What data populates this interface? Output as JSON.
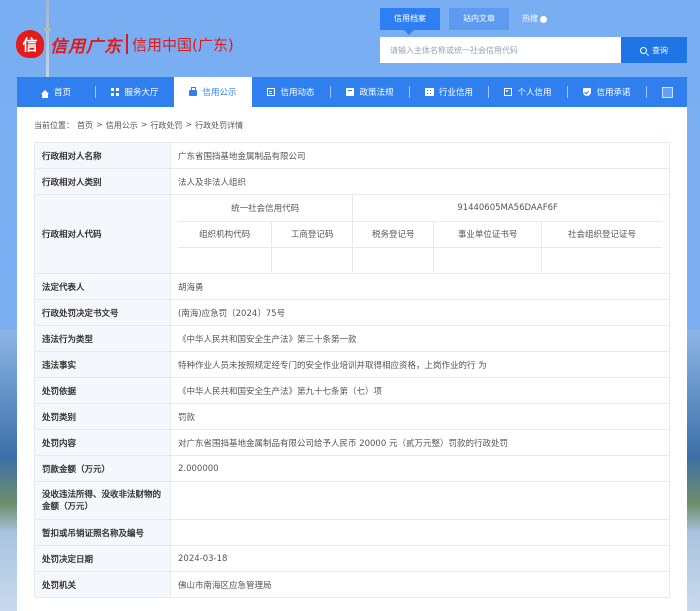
{
  "header": {
    "logo_mark": "信",
    "logo_script": "信用广东",
    "logo_cn": "信用中国(广东)",
    "search_tabs": [
      {
        "label": "信用档案",
        "active": true
      },
      {
        "label": "站内文章",
        "active": false
      },
      {
        "label": "热搜",
        "active": false
      }
    ],
    "search_placeholder": "请输入主体名称或统一社会信用代码",
    "search_button": "查询"
  },
  "nav": {
    "items": [
      {
        "label": "首页",
        "icon": "home-icon",
        "active": false
      },
      {
        "label": "服务大厅",
        "icon": "grid-icon",
        "active": false
      },
      {
        "label": "信用公示",
        "icon": "briefcase-icon",
        "active": true
      },
      {
        "label": "信用动态",
        "icon": "document-icon",
        "active": false
      },
      {
        "label": "政策法规",
        "icon": "book-icon",
        "active": false
      },
      {
        "label": "行业信用",
        "icon": "building-icon",
        "active": false
      },
      {
        "label": "个人信用",
        "icon": "id-card-icon",
        "active": false
      },
      {
        "label": "信用承诺",
        "icon": "shield-check-icon",
        "active": false
      }
    ],
    "expand_icon": "expand-icon"
  },
  "breadcrumb": {
    "prefix": "当前位置：",
    "items": [
      "首页",
      "信用公示",
      "行政处罚",
      "行政处罚详情"
    ],
    "separator": ">"
  },
  "detail": {
    "name_label": "行政相对人名称",
    "name_value": "广东省围挡基地金属制品有限公司",
    "category_label": "行政相对人类别",
    "category_value": "法人及非法人组织",
    "code_label": "行政相对人代码",
    "codes": {
      "uscc_label": "统一社会信用代码",
      "uscc_value": "91440605MA56DAAF6F",
      "sub_headers": [
        "组织机构代码",
        "工商登记码",
        "税务登记号",
        "事业单位证书号",
        "社会组织登记证号"
      ],
      "sub_values": [
        "",
        "",
        "",
        "",
        ""
      ]
    },
    "rows": [
      {
        "label": "法定代表人",
        "value": "胡海勇"
      },
      {
        "label": "行政处罚决定书文号",
        "value": "(南海)应急罚〔2024〕75号"
      },
      {
        "label": "违法行为类型",
        "value": "《中华人民共和国安全生产法》第三十条第一款"
      },
      {
        "label": "违法事实",
        "value": "特种作业人员未按照规定经专门的安全作业培训并取得相应资格，上岗作业的行 为"
      },
      {
        "label": "处罚依据",
        "value": "《中华人民共和国安全生产法》第九十七条第（七）项"
      },
      {
        "label": "处罚类别",
        "value": "罚款"
      },
      {
        "label": "处罚内容",
        "value": "对广东省围挡基地金属制品有限公司给予人民币 20000 元（贰万元整）罚款的行政处罚"
      },
      {
        "label": "罚款金额（万元）",
        "value": "2.000000"
      },
      {
        "label": "没收违法所得、没收非法财物的金额（万元）",
        "value": ""
      },
      {
        "label": "暂扣或吊销证照名称及编号",
        "value": ""
      },
      {
        "label": "处罚决定日期",
        "value": "2024-03-18"
      },
      {
        "label": "处罚机关",
        "value": "佛山市南海区应急管理局"
      }
    ]
  }
}
